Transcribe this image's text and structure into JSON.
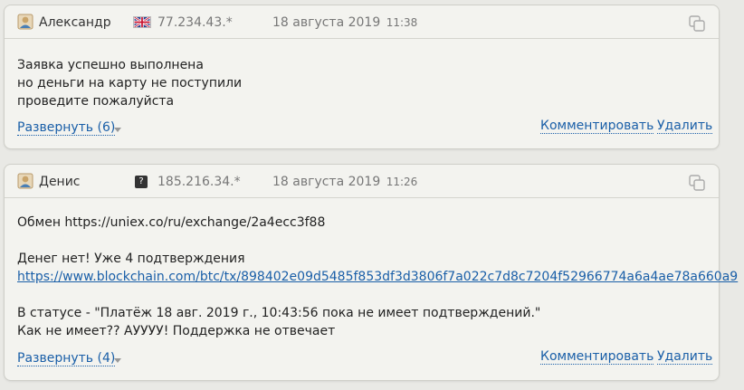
{
  "comments": [
    {
      "author": "Александр",
      "flag": "uk-flag-icon",
      "ip": "77.234.43.*",
      "date": "18 августа 2019",
      "time": "11:38",
      "body_lines": [
        "Заявка успешно выполнена",
        "но деньги на карту не поступили",
        "проведите пожалуйста"
      ],
      "expand_label": "Развернуть (6)",
      "comment_label": "Комментировать",
      "delete_label": "Удалить"
    },
    {
      "author": "Денис",
      "flag": "unknown-flag-icon",
      "flag_glyph": "?",
      "ip": "185.216.34.*",
      "date": "18 августа 2019",
      "time": "11:26",
      "body_line1": "Обмен https://uniex.co/ru/exchange/2a4ecc3f88",
      "body_line2": "Денег нет! Уже 4 подтверждения",
      "body_link": "https://www.blockchain.com/btc/tx/898402e09d5485f853df3d3806f7a022c7d8c7204f52966774a6a4ae78a660a9",
      "body_line3": "В статусе - \"Платёж 18 авг. 2019 г., 10:43:56 пока не имеет подтверждений.\"",
      "body_line4": "Как не имеет?? АУУУУ! Поддержка не отвечает",
      "expand_label": "Развернуть (4)",
      "comment_label": "Комментировать",
      "delete_label": "Удалить"
    }
  ],
  "colors": {
    "link": "#1a5fa8",
    "card_bg": "#f3f3ef",
    "page_bg": "#e9e9e5"
  }
}
